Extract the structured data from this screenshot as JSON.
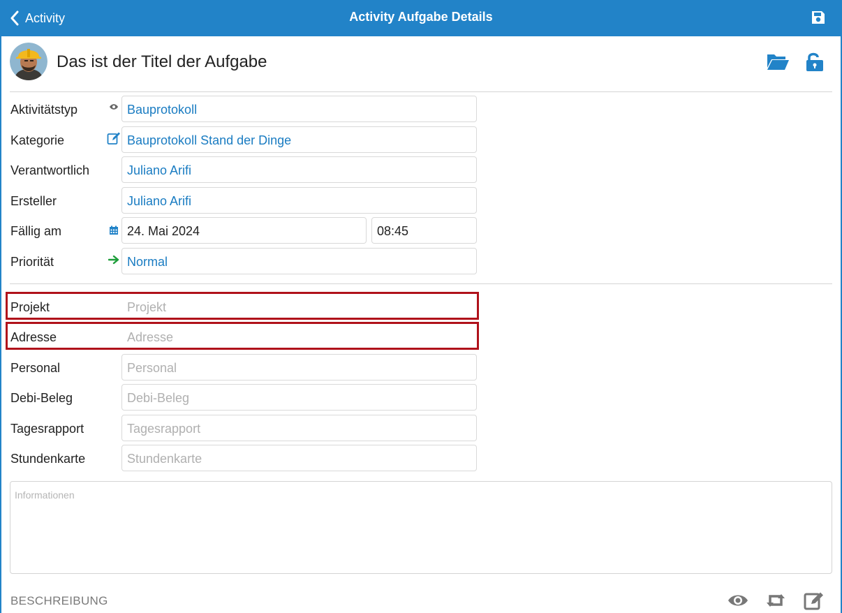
{
  "nav": {
    "back_label": "Activity",
    "title": "Activity Aufgabe Details"
  },
  "header": {
    "title": "Das ist der Titel der Aufgabe"
  },
  "fields": {
    "aktivitaetstyp": {
      "label": "Aktivitätstyp",
      "value": "Bauprotokoll"
    },
    "kategorie": {
      "label": "Kategorie",
      "value": "Bauprotokoll Stand der Dinge"
    },
    "verantwortlich": {
      "label": "Verantwortlich",
      "value": "Juliano Arifi"
    },
    "ersteller": {
      "label": "Ersteller",
      "value": "Juliano Arifi"
    },
    "faellig": {
      "label": "Fällig am",
      "date": "24. Mai 2024",
      "time": "08:45"
    },
    "prioritaet": {
      "label": "Priorität",
      "value": "Normal"
    }
  },
  "links": {
    "projekt": {
      "label": "Projekt",
      "placeholder": "Projekt"
    },
    "adresse": {
      "label": "Adresse",
      "placeholder": "Adresse"
    },
    "personal": {
      "label": "Personal",
      "placeholder": "Personal"
    },
    "debi_beleg": {
      "label": "Debi-Beleg",
      "placeholder": "Debi-Beleg"
    },
    "tagesrapport": {
      "label": "Tagesrapport",
      "placeholder": "Tagesrapport"
    },
    "stundenkarte": {
      "label": "Stundenkarte",
      "placeholder": "Stundenkarte"
    }
  },
  "info": {
    "placeholder": "Informationen"
  },
  "footer": {
    "section_label": "BESCHREIBUNG"
  },
  "icons": {
    "back": "chevron-left-icon",
    "save": "floppy-disk-icon",
    "folder": "folder-open-icon",
    "lock": "unlock-icon",
    "type": "eye-icon",
    "category": "edit-icon",
    "date": "calendar-icon",
    "priority": "arrow-right-icon",
    "preview": "eye-icon",
    "repeat": "retweet-icon",
    "edit": "edit-icon"
  },
  "colors": {
    "accent": "#2283c8",
    "link_text": "#1a7cc2",
    "highlight": "#b0121b",
    "priority_arrow": "#1e9e3a",
    "placeholder": "#b0b0b0"
  }
}
